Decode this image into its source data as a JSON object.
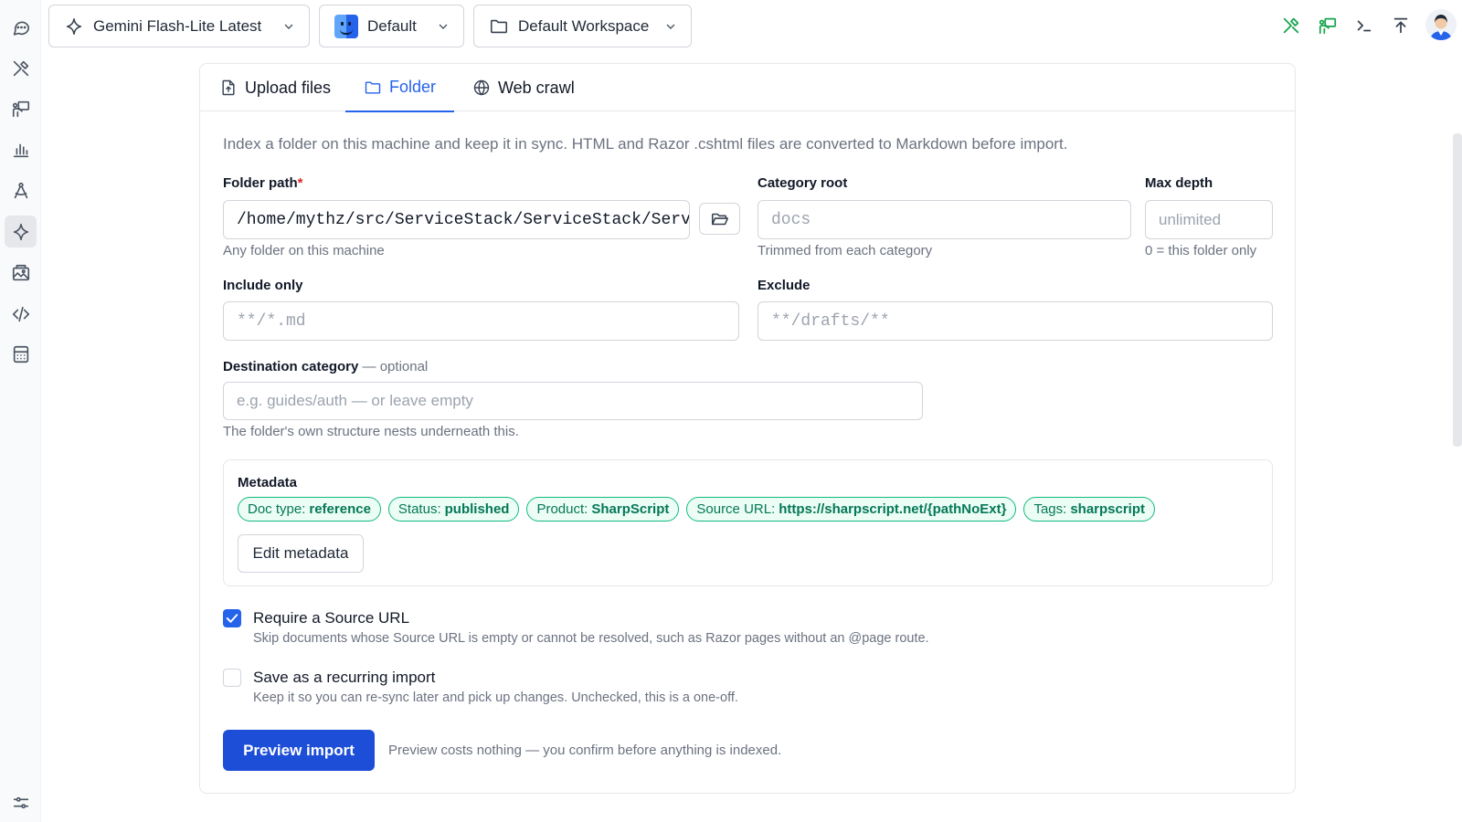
{
  "topbar": {
    "model": {
      "label": "Gemini Flash-Lite Latest",
      "icon": "sparkle-icon"
    },
    "profile": {
      "label": "Default",
      "icon": "finder-icon"
    },
    "workspace": {
      "label": "Default Workspace",
      "icon": "folder-icon"
    },
    "right_icons": [
      "tools-icon",
      "presentation-icon",
      "terminal-icon",
      "upload-icon",
      "user-avatar"
    ],
    "accent_color": "#16a34a"
  },
  "sidebar": {
    "items": [
      {
        "icon": "chat-icon"
      },
      {
        "icon": "tools-icon"
      },
      {
        "icon": "presentation-icon"
      },
      {
        "icon": "bar-chart-icon"
      },
      {
        "icon": "compass-icon"
      },
      {
        "icon": "sparkle-icon",
        "active": true
      },
      {
        "icon": "image-gallery-icon"
      },
      {
        "icon": "code-icon"
      },
      {
        "icon": "calculator-icon"
      },
      {
        "icon": "sliders-icon"
      }
    ]
  },
  "tabs": [
    {
      "label": "Upload files",
      "icon": "file-upload-icon"
    },
    {
      "label": "Folder",
      "icon": "folder-icon",
      "active": true
    },
    {
      "label": "Web crawl",
      "icon": "globe-icon"
    }
  ],
  "form": {
    "intro": "Index a folder on this machine and keep it in sync. HTML and Razor .cshtml files are converted to Markdown before import.",
    "folder_path": {
      "label": "Folder path",
      "required_mark": "*",
      "value": "/home/mythz/src/ServiceStack/ServiceStack/Serv",
      "help": "Any folder on this machine"
    },
    "category_root": {
      "label": "Category root",
      "placeholder": "docs",
      "help": "Trimmed from each category"
    },
    "max_depth": {
      "label": "Max depth",
      "placeholder": "unlimited",
      "help": "0 = this folder only"
    },
    "include_only": {
      "label": "Include only",
      "placeholder": "**/*.md"
    },
    "exclude": {
      "label": "Exclude",
      "placeholder": "**/drafts/**"
    },
    "destination": {
      "label": "Destination category",
      "optional": "— optional",
      "placeholder": "e.g. guides/auth — or leave empty",
      "help": "The folder's own structure nests underneath this."
    }
  },
  "metadata": {
    "title": "Metadata",
    "chips": [
      {
        "key": "Doc type:",
        "value": "reference"
      },
      {
        "key": "Status:",
        "value": "published"
      },
      {
        "key": "Product:",
        "value": "SharpScript"
      },
      {
        "key": "Source URL:",
        "value": "https://sharpscript.net/{pathNoExt}"
      },
      {
        "key": "Tags:",
        "value": "sharpscript"
      }
    ],
    "edit_label": "Edit metadata",
    "chip_color": "#10b981"
  },
  "options": {
    "require_source": {
      "label": "Require a Source URL",
      "help": "Skip documents whose Source URL is empty or cannot be resolved, such as Razor pages without an @page route.",
      "checked": true
    },
    "recurring": {
      "label": "Save as a recurring import",
      "help": "Keep it so you can re-sync later and pick up changes. Unchecked, this is a one-off.",
      "checked": false
    }
  },
  "actions": {
    "preview_label": "Preview import",
    "preview_note": "Preview costs nothing — you confirm before anything is indexed.",
    "primary_color": "#1d4ed8"
  }
}
